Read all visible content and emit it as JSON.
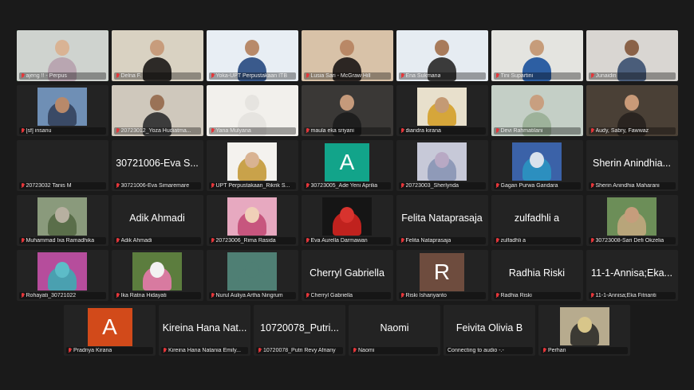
{
  "colors": {
    "background": "#1a1a1a",
    "tile": "#232323",
    "active_speaker_border": "#23d959",
    "muted_icon": "#e5363a"
  },
  "participants": [
    {
      "label": "ajeng !! - Perpus",
      "video": true,
      "active": true,
      "bg": "#cfd3cf",
      "shirt": "#b9a6b1",
      "skin": "#d9b394"
    },
    {
      "label": "Delna F.",
      "video": true,
      "bg": "#d9d2c2",
      "shirt": "#2d2a27",
      "skin": "#c79c7c"
    },
    {
      "label": "Yoka-UPT Perpustakaan ITB",
      "video": true,
      "bg": "#e8eef4",
      "shirt": "#3a5a8c",
      "skin": "#b88a6a"
    },
    {
      "label": "Lusia Sari - McGraw Hill",
      "video": true,
      "bg": "#d8c2a8",
      "shirt": "#2c2623",
      "skin": "#b98866"
    },
    {
      "label": "Ena Sukmana",
      "video": true,
      "bg": "#e6ecf2",
      "shirt": "#3b3b3b",
      "skin": "#a87b5b"
    },
    {
      "label": "Tini Supartini",
      "video": true,
      "bg": "#e4e4e0",
      "shirt": "#2d5fa3",
      "skin": "#c69c7a"
    },
    {
      "label": "Junaidin",
      "video": true,
      "bg": "#d9d6d2",
      "shirt": "#4a5d7a",
      "skin": "#8a6248"
    },
    {
      "label": "[sf] insanu",
      "video": true,
      "box": true,
      "bg": "#6f8fb5",
      "shirt": "#3a4a66",
      "skin": "#b8896a"
    },
    {
      "label": "20723012_Yoza Hudiatma...",
      "video": true,
      "bg": "#cfc8bc",
      "shirt": "#3c3c3c",
      "skin": "#9a7256"
    },
    {
      "label": "Yana Mulyana",
      "video": true,
      "bg": "#f2f0ec",
      "shirt": "#e6e4e0",
      "skin": "#e6e4e0"
    },
    {
      "label": "maula eka sriyani",
      "video": true,
      "bg": "#3a3836",
      "shirt": "#1e1e1e",
      "skin": "#c59a7b"
    },
    {
      "label": "diandra kirana",
      "video": true,
      "box": true,
      "bg": "#e8e0cc",
      "shirt": "#d6a63a",
      "skin": "#c49a74"
    },
    {
      "label": "Devi Rahmatilani",
      "video": true,
      "bg": "#c4cfc6",
      "shirt": "#9db29a",
      "skin": "#c89f80"
    },
    {
      "label": "Audy, Sabry, Fawwaz",
      "video": true,
      "bg": "#4a4036",
      "shirt": "#2a2420",
      "skin": "#c99a78"
    },
    {
      "label": "20723032 Tanis M",
      "video": false,
      "center": ""
    },
    {
      "label": "30721006-Eva Simaremare",
      "video": false,
      "center": "30721006-Eva S..."
    },
    {
      "label": "UPT Perpustakaan_Rikrik S...",
      "video": true,
      "box": true,
      "bg": "#f4f2ee",
      "shirt": "#c9a24a",
      "skin": "#d9b392"
    },
    {
      "label": "30723005_Ade Yeni Aprilia",
      "video": false,
      "letter": "A",
      "letter_bg": "#12a48a"
    },
    {
      "label": "20723003_Sherlynda",
      "video": true,
      "box": true,
      "bg": "#c7c9d8",
      "shirt": "#8f9ab8",
      "skin": "#b8a9c4"
    },
    {
      "label": "Gagan Purwa Gandara",
      "video": true,
      "box": true,
      "bg": "#3b62a8",
      "shirt": "#2c8fbf",
      "skin": "#d9e2ec"
    },
    {
      "label": "Sherin Anindhia Maharani",
      "video": false,
      "center": "Sherin Anindhia..."
    },
    {
      "label": "Muhammad Ixa Ramadhika",
      "video": true,
      "box": true,
      "bg": "#8a9a7c",
      "shirt": "#5a6e4a",
      "skin": "#b7b0a0"
    },
    {
      "label": "Adik Ahmadi",
      "video": false,
      "center": "Adik Ahmadi"
    },
    {
      "label": "20723006_Rima Rasida",
      "video": true,
      "box": true,
      "bg": "#e7a9c0",
      "shirt": "#c7567e",
      "skin": "#f0d0b8"
    },
    {
      "label": "Eva Aurella Darmawan",
      "video": true,
      "box": true,
      "bg": "#151515",
      "shirt": "#c0221e",
      "skin": "#d8332e"
    },
    {
      "label": "Felita Nataprasaja",
      "video": false,
      "center": "Felita Nataprasaja"
    },
    {
      "label": "zulfadhli a",
      "video": false,
      "center": "zulfadhli a"
    },
    {
      "label": "30723008-Sari Defi Okzelia",
      "video": true,
      "box": true,
      "bg": "#6c8e58",
      "shirt": "#b8a57a",
      "skin": "#c69d7c"
    },
    {
      "label": "Rohayati_30721022",
      "video": true,
      "box": true,
      "bg": "#b64d9c",
      "shirt": "#4aa0b0",
      "skin": "#5dbcc8"
    },
    {
      "label": "Ika Ratna Hidayati",
      "video": true,
      "box": true,
      "bg": "#5c7d3e",
      "shirt": "#d87aa0",
      "skin": "#f2f2f2"
    },
    {
      "label": "Nurul Auliya Artha Ningrum",
      "video": true,
      "box": true,
      "bg": "#4f7f74",
      "shirt": "#4f7f74",
      "skin": "#4f7f74"
    },
    {
      "label": "Cherryl Gabriella",
      "video": false,
      "center": "Cherryl Gabriella"
    },
    {
      "label": "Riski Ishariyanto",
      "video": false,
      "letter": "R",
      "letter_bg": "#6e4c3e"
    },
    {
      "label": "Radhia Riski",
      "video": false,
      "center": "Radhia Riski"
    },
    {
      "label": "11-1-Annisa;Eka Fitrianti",
      "video": false,
      "center": "11-1-Annisa;Eka..."
    },
    {
      "label": "Pradnya Kirana",
      "video": false,
      "letter": "A",
      "letter_bg": "#d24a1a"
    },
    {
      "label": "Kireina Hana Natania Emily...",
      "video": false,
      "center": "Kireina Hana Nat..."
    },
    {
      "label": "10720078_Putri Revy Afriany",
      "video": false,
      "center": "10720078_Putri..."
    },
    {
      "label": "Naomi",
      "video": false,
      "center": "Naomi"
    },
    {
      "label": "Connecting to audio  -.-",
      "video": false,
      "center": "Feivita Olivia B",
      "no_mic": true
    },
    {
      "label": "Perhan",
      "video": true,
      "box": true,
      "bg": "#b7ab8e",
      "shirt": "#3c3a34",
      "skin": "#d8c68a"
    }
  ]
}
